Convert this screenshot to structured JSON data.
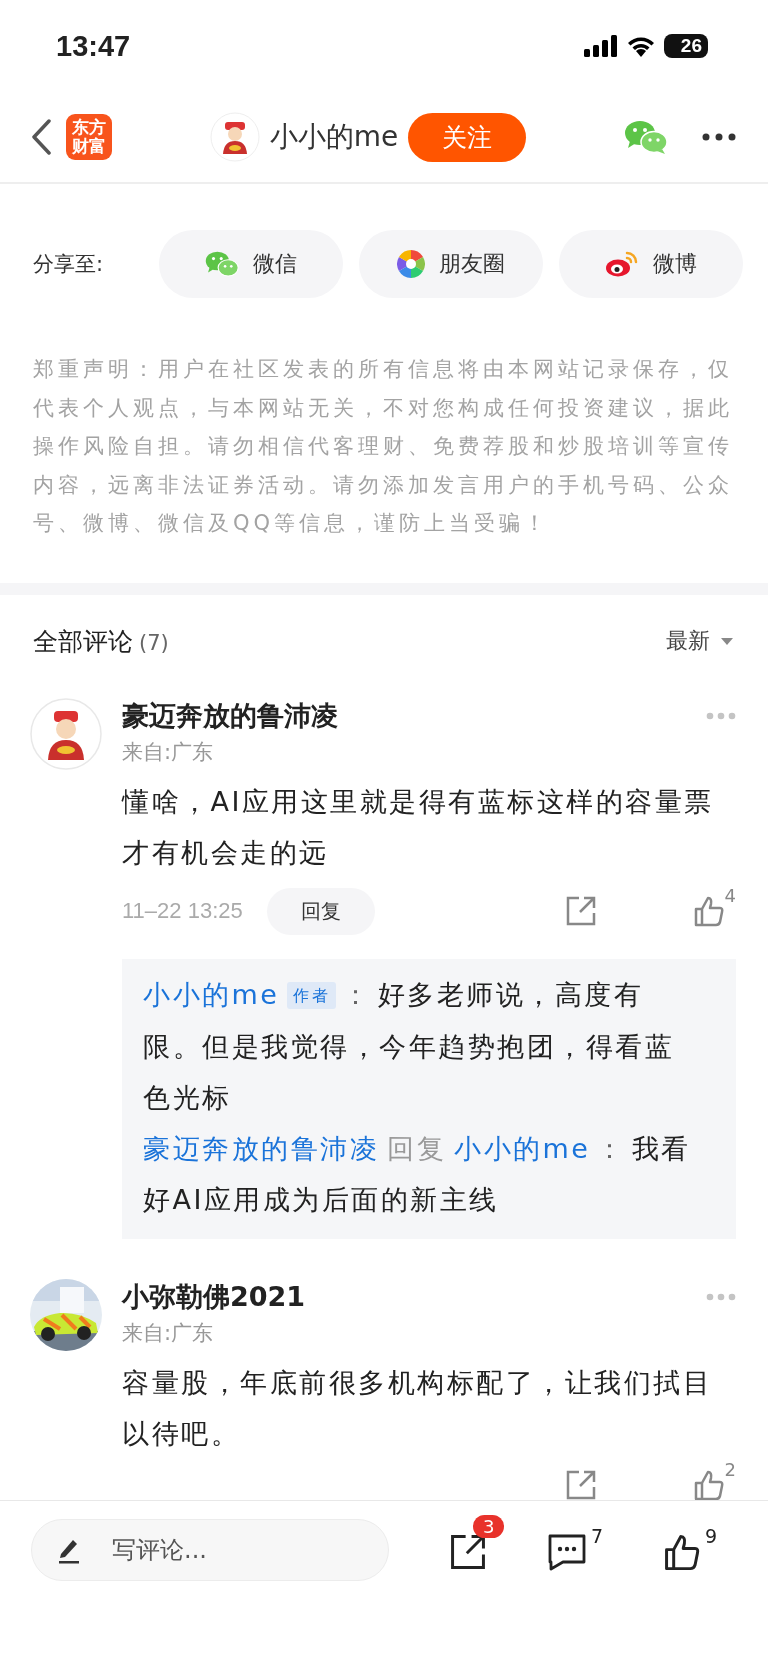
{
  "status_bar": {
    "time": "13:47",
    "battery": "26"
  },
  "nav": {
    "logo_lines": [
      "东方",
      "财富"
    ],
    "author": "小小的me",
    "follow_button": "关注"
  },
  "share": {
    "label": "分享至:",
    "targets": [
      {
        "kind": "wechat",
        "label": "微信"
      },
      {
        "kind": "moments",
        "label": "朋友圈"
      },
      {
        "kind": "weibo",
        "label": "微博"
      }
    ]
  },
  "disclaimer": "郑重声明：用户在社区发表的所有信息将由本网站记录保存，仅代表个人观点，与本网站无关，不对您构成任何投资建议，据此操作风险自担。请勿相信代客理财、免费荐股和炒股培训等宣传内容，远离非法证券活动。请勿添加发言用户的手机号码、公众号、微博、微信及QQ等信息，谨防上当受骗！",
  "comments_header": {
    "title": "全部评论",
    "count": "(7)",
    "sort": "最新"
  },
  "comments": [
    {
      "avatar": {
        "kind": "figure"
      },
      "name": "豪迈奔放的鲁沛凌",
      "location": "来自:广东",
      "text": "懂啥，AI应用这里就是得有蓝标这样的容量票才有机会走的远",
      "time": "11–22 13:25",
      "reply_button": "回复",
      "likes": "4",
      "replies": [
        {
          "author": "小小的me",
          "badge": "作者",
          "separator": "：",
          "text": "好多老师说，高度有限。但是我觉得，今年趋势抱团，得看蓝色光标"
        },
        {
          "author": "豪迈奔放的鲁沛凌",
          "verb": "回复",
          "target": "小小的me",
          "separator": "：",
          "text": "我看好AI应用成为后面的新主线"
        }
      ]
    },
    {
      "name": "小弥勒佛2021",
      "location": "来自:广东",
      "text": "容量股，年底前很多机构标配了，让我们拭目以待吧。",
      "likes": "2"
    }
  ],
  "bottom_bar": {
    "placeholder": "写评论...",
    "share_badge": "3",
    "comment_count": "7",
    "like_count": "9"
  }
}
